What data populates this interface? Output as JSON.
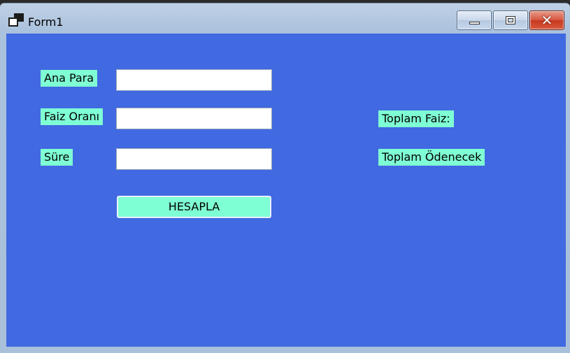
{
  "window": {
    "title": "Form1",
    "icon": "form-window-icon",
    "controls": {
      "minimize": "minimize-icon",
      "maximize": "maximize-icon",
      "close_symbol": "✕"
    }
  },
  "colors": {
    "client_background": "#4169e1",
    "label_background": "#7fffd4",
    "button_background": "#7fffd4"
  },
  "form": {
    "fields": [
      {
        "label": "Ana Para",
        "value": ""
      },
      {
        "label": "Faiz Oranı",
        "value": ""
      },
      {
        "label": "Süre",
        "value": ""
      }
    ],
    "calculate_button": "HESAPLA",
    "results": {
      "total_interest_label": "Toplam Faiz:",
      "total_payment_label": "Toplam Ödenecek"
    }
  }
}
